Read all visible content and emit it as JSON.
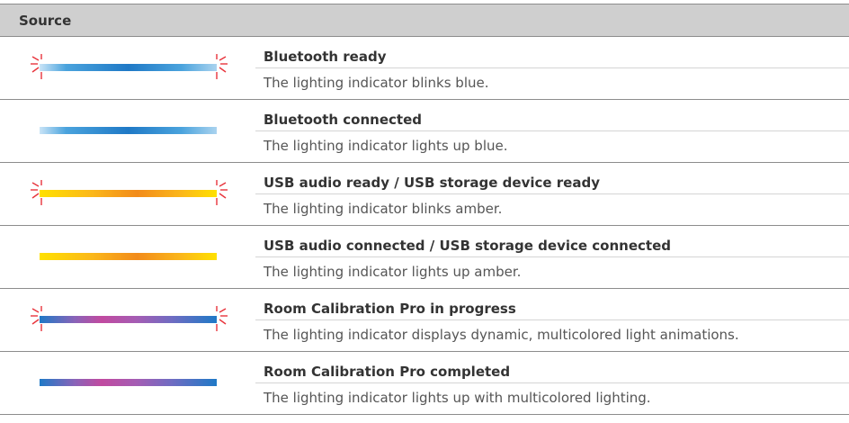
{
  "header": {
    "label": "Source"
  },
  "rows": [
    {
      "title": "Bluetooth ready",
      "description": "The lighting indicator blinks blue.",
      "color": "blue",
      "state": "blinking"
    },
    {
      "title": "Bluetooth connected",
      "description": "The lighting indicator lights up blue.",
      "color": "blue",
      "state": "solid"
    },
    {
      "title": "USB audio ready / USB storage device ready",
      "description": "The lighting indicator blinks amber.",
      "color": "amber",
      "state": "blinking"
    },
    {
      "title": "USB audio connected / USB storage device connected",
      "description": "The lighting indicator lights up amber.",
      "color": "amber",
      "state": "solid"
    },
    {
      "title": "Room Calibration Pro in progress",
      "description": "The lighting indicator displays dynamic, multicolored light animations.",
      "color": "multicolor",
      "state": "blinking"
    },
    {
      "title": "Room Calibration Pro completed",
      "description": "The lighting indicator lights up with multicolored lighting.",
      "color": "multicolor",
      "state": "solid"
    }
  ],
  "colors": {
    "blue": "#1f79c6",
    "amber": "#f28b1a",
    "multicolor": "#c14aa0",
    "blink_marks": "#e8333b",
    "header_bg": "#cfcfcf"
  }
}
